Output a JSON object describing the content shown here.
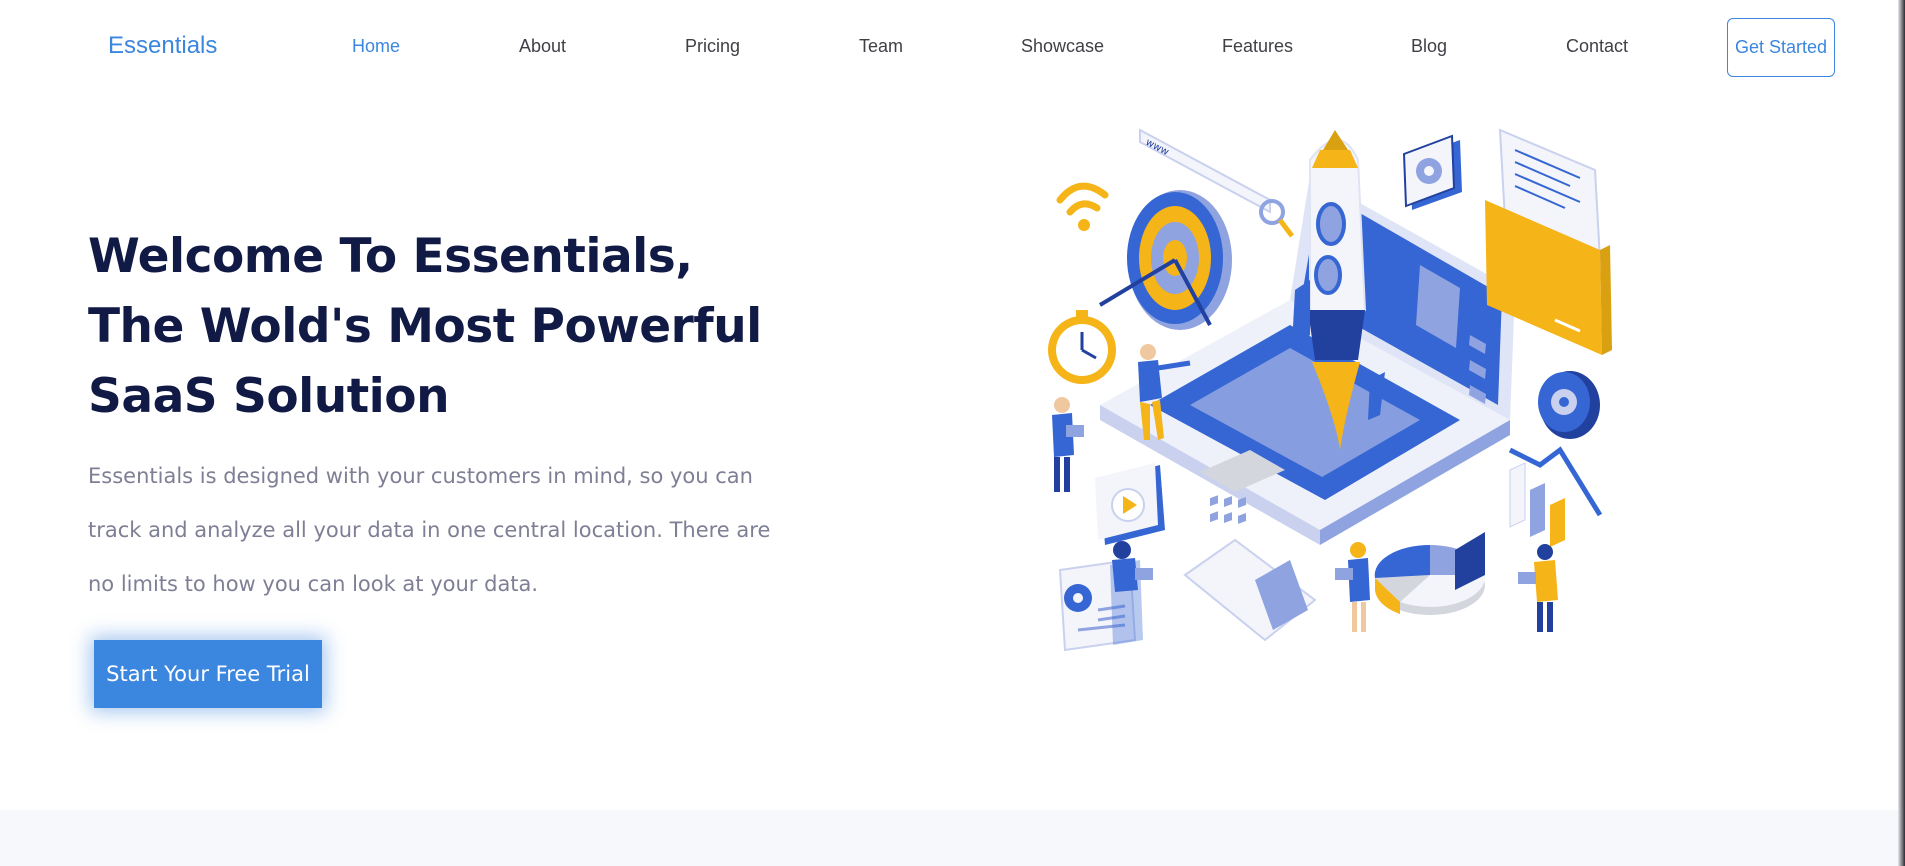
{
  "nav": {
    "brand": "Essentials",
    "links": [
      {
        "label": "Home",
        "active": true
      },
      {
        "label": "About",
        "active": false
      },
      {
        "label": "Pricing",
        "active": false
      },
      {
        "label": "Team",
        "active": false
      },
      {
        "label": "Showcase",
        "active": false
      },
      {
        "label": "Features",
        "active": false
      },
      {
        "label": "Blog",
        "active": false
      },
      {
        "label": "Contact",
        "active": false
      }
    ],
    "cta_label": "Get Started"
  },
  "hero": {
    "title_lines": [
      "Welcome To Essentials,",
      "The Wold's Most Powerful",
      "SaaS Solution"
    ],
    "description_lines": [
      "Essentials is designed with your customers in mind, so you can",
      "track and analyze all your data in one central location. There are",
      "no limits to how you can look at your data."
    ],
    "cta_label": "Start Your Free Trial",
    "illustration_text": "www"
  },
  "colors": {
    "accent": "#3b86de",
    "heading": "#111a45",
    "body_text": "#7e7f95",
    "nav_text": "#3f3f46",
    "illustration_blue": "#3566d3",
    "illustration_light_blue": "#8fa3e0",
    "illustration_yellow": "#f5b418",
    "section_band": "#f7f8fb"
  }
}
